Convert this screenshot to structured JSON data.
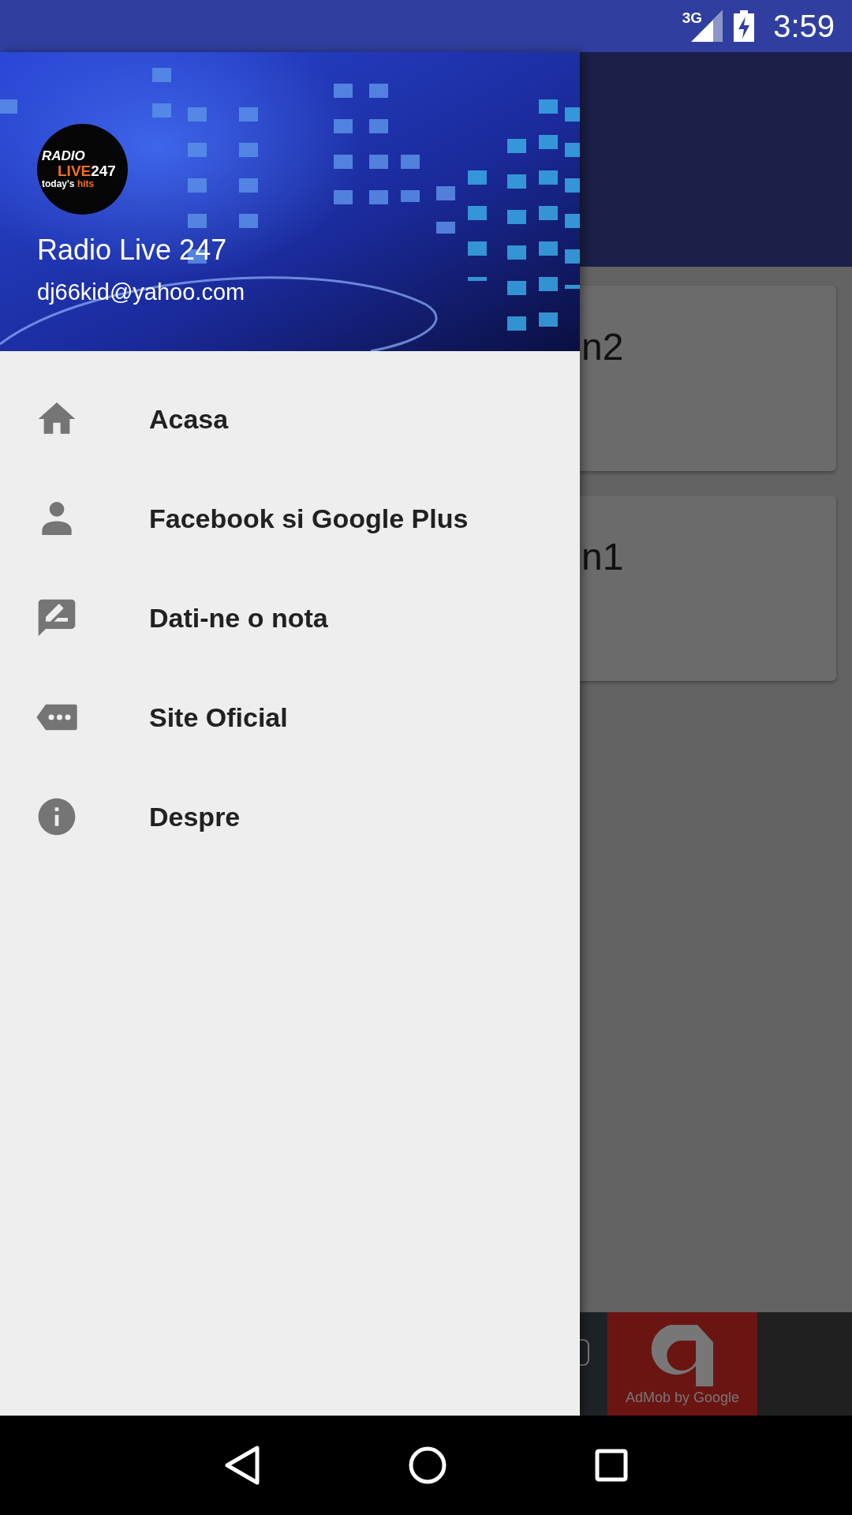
{
  "status_bar": {
    "network": "3G",
    "time": "3:59"
  },
  "drawer": {
    "logo": {
      "top": "RADIO",
      "middle_accent": "LIVE",
      "middle": "247",
      "bottom": "today's",
      "bottom_accent": "hits"
    },
    "title": "Radio Live 247",
    "email": "dj66kid@yahoo.com",
    "items": [
      {
        "kind": "home",
        "label": "Acasa"
      },
      {
        "kind": "person",
        "label": "Facebook si Google Plus"
      },
      {
        "kind": "review",
        "label": "Dati-ne o nota"
      },
      {
        "kind": "label",
        "label": "Site Oficial"
      },
      {
        "kind": "info",
        "label": "Despre"
      }
    ]
  },
  "content": {
    "cards": [
      {
        "title": "n2"
      },
      {
        "title": "n1"
      }
    ],
    "ad": {
      "text": "AdMob by Google"
    }
  }
}
